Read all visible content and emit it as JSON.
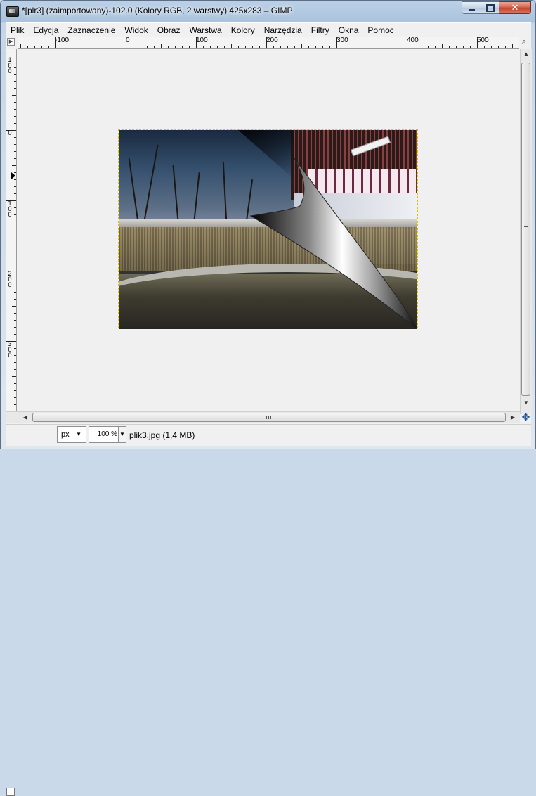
{
  "window": {
    "title": "*[plr3] (zaimportowany)-102.0 (Kolory RGB, 2 warstwy) 425x283 – GIMP",
    "close_label": "✕"
  },
  "menu": {
    "items": [
      "Plik",
      "Edycja",
      "Zaznaczenie",
      "Widok",
      "Obraz",
      "Warstwa",
      "Kolory",
      "Narzędzia",
      "Filtry",
      "Okna",
      "Pomoc"
    ]
  },
  "rulers": {
    "horizontal_labels": [
      "-100",
      "0",
      "100",
      "200",
      "300",
      "400",
      "500"
    ],
    "vertical_labels": [
      "100",
      "0",
      "100",
      "200",
      "300"
    ]
  },
  "statusbar": {
    "unit": "px",
    "zoom": "100 %",
    "status_text": "plik3.jpg (1,4 MB)"
  },
  "icons": {
    "ruler_corner": "menu-arrow-icon",
    "zoom_fit": "zoom-icon",
    "navigate": "navigate-move-icon",
    "quick_mask": "quick-mask-icon"
  },
  "colors": {
    "selection_border": "#d8c400",
    "close_button": "#c2402c"
  }
}
